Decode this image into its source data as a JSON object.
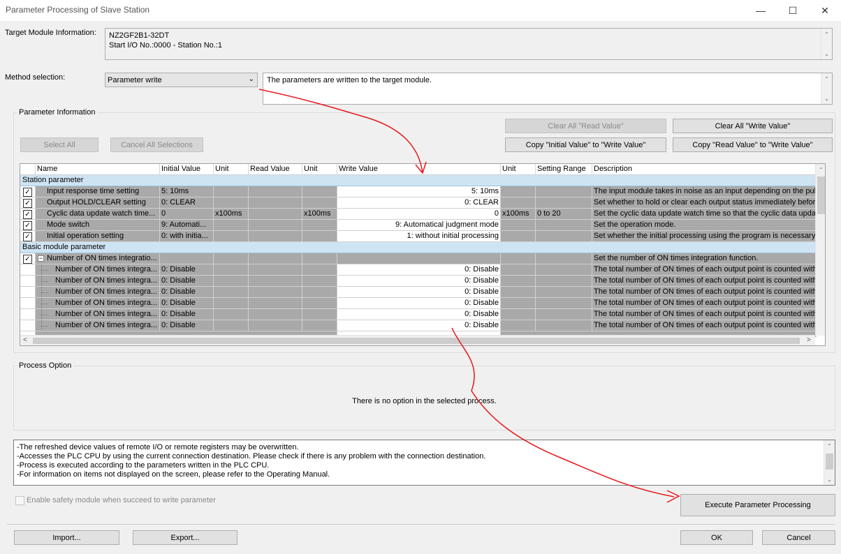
{
  "window": {
    "title": "Parameter Processing of Slave Station"
  },
  "target_module": {
    "label": "Target Module Information:",
    "line1": "NZ2GF2B1-32DT",
    "line2": "Start I/O No.:0000 - Station No.:1"
  },
  "method": {
    "label": "Method selection:",
    "selected": "Parameter write",
    "description": "The parameters are written to the target module."
  },
  "param_info": {
    "title": "Parameter Information",
    "buttons": {
      "clear_read": "Clear All \"Read Value\"",
      "clear_write": "Clear All \"Write Value\"",
      "select_all": "Select All",
      "cancel_all": "Cancel All Selections",
      "copy_initial": "Copy \"Initial Value\" to \"Write Value\"",
      "copy_read": "Copy \"Read Value\" to \"Write Value\""
    },
    "columns": [
      "Name",
      "Initial Value",
      "Unit",
      "Read Value",
      "Unit",
      "Write Value",
      "Unit",
      "Setting Range",
      "Description"
    ],
    "sections": {
      "station": "Station parameter",
      "basic": "Basic module parameter"
    },
    "station_rows": [
      {
        "name": "Input response time setting",
        "initial": "5: 10ms",
        "unit": "",
        "read": "",
        "runit": "",
        "write": "5: 10ms",
        "wunit": "",
        "range": "",
        "desc": "The input module takes in noise as an input depending on the puls"
      },
      {
        "name": "Output HOLD/CLEAR setting",
        "initial": "0: CLEAR",
        "unit": "",
        "read": "",
        "runit": "",
        "write": "0: CLEAR",
        "wunit": "",
        "range": "",
        "desc": "Set whether to hold or clear each output status immediately befor"
      },
      {
        "name": "Cyclic data update watch time...",
        "initial": "0",
        "unit": "x100ms",
        "read": "",
        "runit": "x100ms",
        "write": "0",
        "wunit": "x100ms",
        "range": "0 to 20",
        "desc": "Set the cyclic data update watch time so that the cyclic data upda"
      },
      {
        "name": "Mode switch",
        "initial": "9: Automati...",
        "unit": "",
        "read": "",
        "runit": "",
        "write": "9: Automatical judgment mode",
        "wunit": "",
        "range": "",
        "desc": "Set the operation mode."
      },
      {
        "name": "Initial operation setting",
        "initial": "0: with initia...",
        "unit": "",
        "read": "",
        "runit": "",
        "write": "1: without initial processing",
        "wunit": "",
        "range": "",
        "desc": "Set whether the initial processing using the program is necessary o"
      }
    ],
    "basic_parent": {
      "name": "Number of ON times integratio...",
      "desc": "Set the number of ON times integration function."
    },
    "basic_rows": [
      {
        "name": "Number of ON times integra...",
        "initial": "0: Disable",
        "write": "0: Disable",
        "desc": "The total number of ON times of each output point is counted with"
      },
      {
        "name": "Number of ON times integra...",
        "initial": "0: Disable",
        "write": "0: Disable",
        "desc": "The total number of ON times of each output point is counted with"
      },
      {
        "name": "Number of ON times integra...",
        "initial": "0: Disable",
        "write": "0: Disable",
        "desc": "The total number of ON times of each output point is counted with"
      },
      {
        "name": "Number of ON times integra...",
        "initial": "0: Disable",
        "write": "0: Disable",
        "desc": "The total number of ON times of each output point is counted with"
      },
      {
        "name": "Number of ON times integra...",
        "initial": "0: Disable",
        "write": "0: Disable",
        "desc": "The total number of ON times of each output point is counted with"
      },
      {
        "name": "Number of ON times integra...",
        "initial": "0: Disable",
        "write": "0: Disable",
        "desc": "The total number of ON times of each output point is counted with"
      }
    ]
  },
  "process_option": {
    "title": "Process Option",
    "message": "There is no option in the selected process."
  },
  "notes": [
    "-The refreshed device values of remote I/O or remote registers may be overwritten.",
    "-Accesses the PLC CPU by using the current connection destination. Please check if there is any problem with the connection destination.",
    "-Process is executed according to the parameters written in the PLC CPU.",
    "-For information on items not displayed on the screen, please refer to the Operating Manual."
  ],
  "safety_checkbox": "Enable safety module when succeed to write parameter",
  "buttons": {
    "execute": "Execute Parameter Processing",
    "import": "Import...",
    "export": "Export...",
    "ok": "OK",
    "cancel": "Cancel"
  },
  "colors": {
    "accent_annotation": "#e8161b",
    "section_bg": "#cfe4f3",
    "grid_gray": "#a9a9a9"
  }
}
